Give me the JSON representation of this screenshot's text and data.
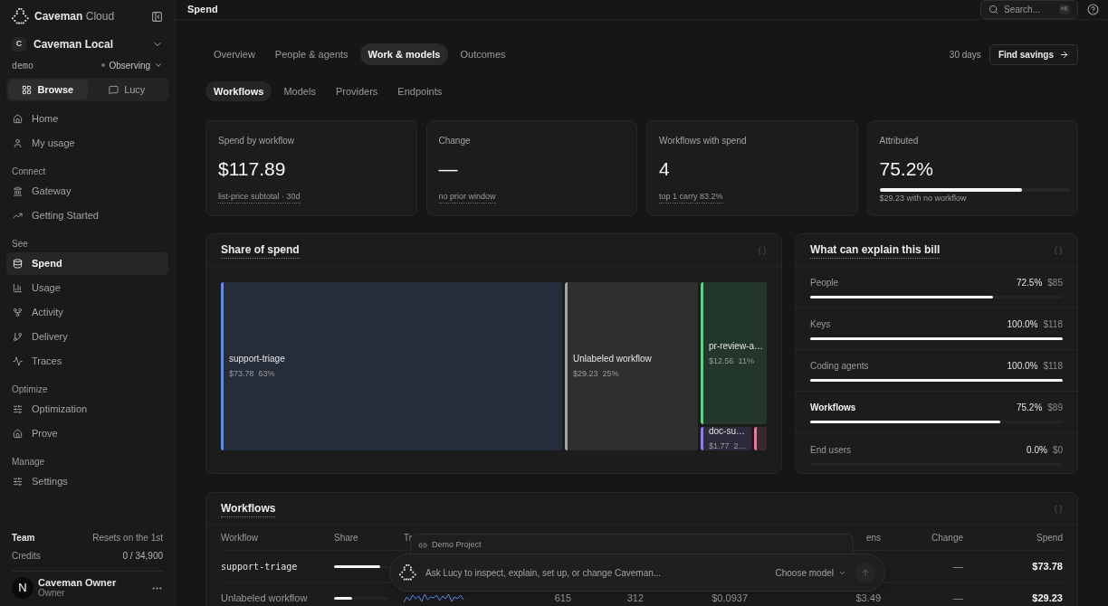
{
  "sidebar": {
    "brand": {
      "name": "Caveman",
      "suffix": "Cloud"
    },
    "workspace": {
      "initial": "C",
      "name": "Caveman Local"
    },
    "environment": "demo",
    "status": "Observing",
    "modes": [
      {
        "label": "Browse",
        "selected": true
      },
      {
        "label": "Lucy",
        "selected": false
      }
    ],
    "sections": [
      {
        "items": [
          {
            "label": "Home",
            "selected": false
          },
          {
            "label": "My usage",
            "selected": false
          }
        ]
      },
      {
        "title": "Connect",
        "items": [
          {
            "label": "Gateway",
            "selected": false
          },
          {
            "label": "Getting Started",
            "selected": false
          }
        ]
      },
      {
        "title": "See",
        "items": [
          {
            "label": "Spend",
            "selected": true
          },
          {
            "label": "Usage",
            "selected": false
          },
          {
            "label": "Activity",
            "selected": false
          },
          {
            "label": "Delivery",
            "selected": false
          },
          {
            "label": "Traces",
            "selected": false
          }
        ]
      },
      {
        "title": "Optimize",
        "items": [
          {
            "label": "Optimization",
            "selected": false
          },
          {
            "label": "Prove",
            "selected": false
          }
        ]
      },
      {
        "title": "Manage",
        "items": [
          {
            "label": "Settings",
            "selected": false
          }
        ]
      }
    ],
    "team": {
      "label": "Team",
      "resets": "Resets on the 1st",
      "credits_label": "Credits",
      "credits": "0 / 34,900"
    },
    "user": {
      "initial": "N",
      "name": "Caveman Owner",
      "role": "Owner"
    }
  },
  "topbar": {
    "title": "Spend",
    "search": {
      "placeholder": "Search...",
      "shortcut": "⌘K"
    }
  },
  "tabs": [
    {
      "label": "Overview",
      "selected": false
    },
    {
      "label": "People & agents",
      "selected": false
    },
    {
      "label": "Work & models",
      "selected": true
    },
    {
      "label": "Outcomes",
      "selected": false
    }
  ],
  "range": "30 days",
  "find_savings": "Find savings",
  "subtabs": [
    {
      "label": "Workflows",
      "selected": true
    },
    {
      "label": "Models",
      "selected": false
    },
    {
      "label": "Providers",
      "selected": false
    },
    {
      "label": "Endpoints",
      "selected": false
    }
  ],
  "stats": [
    {
      "label": "Spend by workflow",
      "value": "$117.89",
      "note": "list-price subtotal · 30d"
    },
    {
      "label": "Change",
      "value": "—",
      "note": "no prior window"
    },
    {
      "label": "Workflows with spend",
      "value": "4",
      "note": "top 1 carry 83.2%"
    },
    {
      "label": "Attributed",
      "value": "75.2%",
      "note": "$29.23 with no workflow",
      "level": 0.752
    }
  ],
  "share": {
    "title": "Share of spend",
    "tiles": [
      {
        "name": "support-triage",
        "amount": "$73.78",
        "pct": "63%",
        "color": "#5b8def"
      },
      {
        "name": "Unlabeled workflow",
        "amount": "$29.23",
        "pct": "25%",
        "color": "#a3a3a3"
      },
      {
        "name": "pr-review-a…",
        "amount": "$12.56",
        "pct": "11%",
        "color": "#4ade80"
      },
      {
        "name": "doc-su…",
        "amount": "$1.77",
        "pct": "2…",
        "color": "#8b7cf6"
      },
      {
        "color": "#f472a0"
      }
    ]
  },
  "explain": {
    "title": "What can explain this bill",
    "rows": [
      {
        "label": "People",
        "pct": "72.5%",
        "amount": "$85",
        "level": 0.725,
        "selected": false
      },
      {
        "label": "Keys",
        "pct": "100.0%",
        "amount": "$118",
        "level": 1,
        "selected": false
      },
      {
        "label": "Coding agents",
        "pct": "100.0%",
        "amount": "$118",
        "level": 1,
        "selected": false
      },
      {
        "label": "Workflows",
        "pct": "75.2%",
        "amount": "$89",
        "level": 0.752,
        "selected": true
      },
      {
        "label": "End users",
        "pct": "0.0%",
        "amount": "$0",
        "level": 0,
        "selected": false
      }
    ]
  },
  "workflows": {
    "title": "Workflows",
    "columns": [
      "Workflow",
      "Share",
      "Tr",
      "",
      "",
      "",
      "ens",
      "Change",
      "Spend"
    ],
    "rows": [
      {
        "workflow": "support-triage",
        "level": 0.85,
        "trend": false,
        "cells": [
          "",
          "",
          "",
          "",
          "—",
          "$73.78"
        ]
      },
      {
        "workflow": "Unlabeled workflow",
        "level": 0.33,
        "trend": true,
        "cells": [
          "615",
          "312",
          "$0.0937",
          "$3.49",
          "—",
          "$29.23"
        ]
      }
    ]
  },
  "lucy": {
    "project": "Demo Project",
    "placeholder": "Ask Lucy to inspect, explain, set up, or change Caveman...",
    "model": "Choose model"
  }
}
